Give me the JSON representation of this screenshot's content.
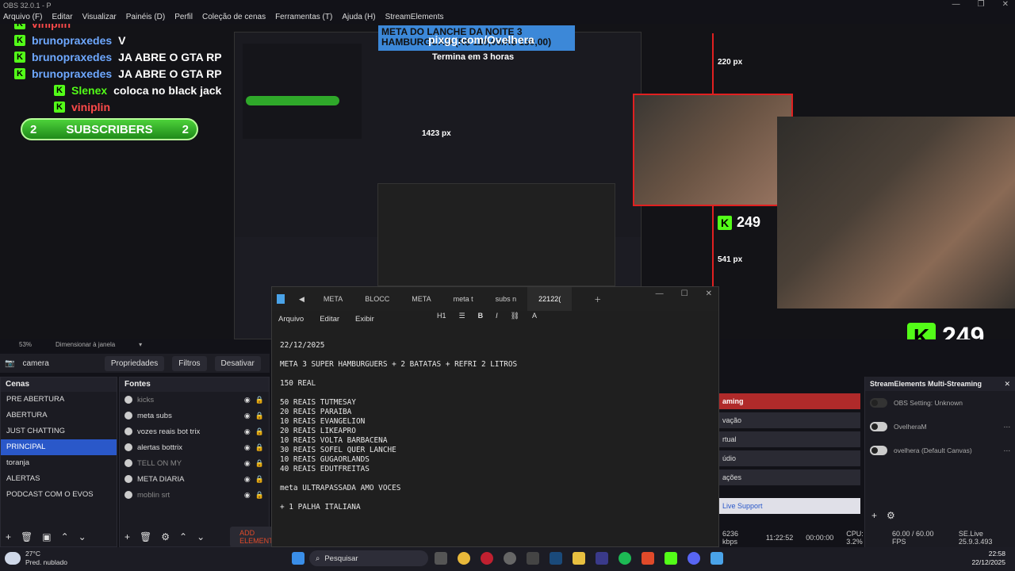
{
  "window": {
    "title": "OBS 32.0.1 - P",
    "menu": [
      "Arquivo (F)",
      "Editar",
      "Visualizar",
      "Painéis (D)",
      "Perfil",
      "Coleção de cenas",
      "Ferramentas (T)",
      "Ajuda (H)",
      "StreamElements"
    ]
  },
  "preview": {
    "url_banner": "pixgg.com/Ovelhera",
    "meta_banner_line1": "META DO LANCHE DA NOITE 3",
    "meta_banner_line2": "HAMBURGUAO (R$ 110,00/R$ 150,00)",
    "termina": "Termina em 3 horas",
    "chat": [
      {
        "user": "viniplin",
        "msg": "",
        "color": "red"
      },
      {
        "user": "brunopraxedes",
        "msg": "V",
        "color": "blue"
      },
      {
        "user": "brunopraxedes",
        "msg": "JA ABRE O GTA RP",
        "color": "blue"
      },
      {
        "user": "brunopraxedes",
        "msg": "JA ABRE O GTA RP",
        "color": "blue"
      },
      {
        "user": "Slenex",
        "msg": "coloca no black jack",
        "color": "green"
      },
      {
        "user": "viniplin",
        "msg": "",
        "color": "red"
      }
    ],
    "subscribers_label": "SUBSCRIBERS",
    "subscribers_count_left": "2",
    "subscribers_count_right": "2",
    "kick_count_big": "249",
    "kick_count_mid": "249",
    "size_220": "220 px",
    "size_541": "541 px",
    "size_1423": "1423 px",
    "k_letter": "K"
  },
  "zoom": {
    "percent": "53%",
    "mode": "Dimensionar à janela"
  },
  "source_toolbar": {
    "camera": "camera",
    "props": "Propriedades",
    "filters": "Filtros",
    "deactivate": "Desativar"
  },
  "scenes": {
    "title": "Cenas",
    "items": [
      "PRE ABERTURA",
      "ABERTURA",
      "JUST CHATTING",
      "PRINCIPAL",
      "toranja",
      "ALERTAS",
      "PODCAST COM O EVOS"
    ],
    "active_index": 3
  },
  "sources": {
    "title": "Fontes",
    "items": [
      {
        "name": "kicks",
        "dim": true
      },
      {
        "name": "meta subs",
        "dim": false
      },
      {
        "name": "vozes reais bot trix",
        "dim": false
      },
      {
        "name": "alertas bottrix",
        "dim": false
      },
      {
        "name": "TELL ON MY",
        "dim": true
      },
      {
        "name": "META DIARIA",
        "dim": false
      },
      {
        "name": "moblin srt",
        "dim": true
      }
    ],
    "add_element": "ADD ELEMENT"
  },
  "controls": {
    "items": [
      "aming",
      "vação",
      "rtual",
      "údio",
      "ações"
    ],
    "live_support": "Live Support"
  },
  "streamelements": {
    "title": "StreamElements Multi-Streaming",
    "rows": [
      {
        "label": "OBS Setting: Unknown",
        "on": false
      },
      {
        "label": "OvelheraM",
        "on": true
      },
      {
        "label": "ovelhera (Default Canvas)",
        "on": true
      }
    ]
  },
  "status_bar": {
    "kbps": "6236 kbps",
    "time1": "11:22:52",
    "time2": "00:00:00",
    "cpu": "CPU: 3.2%",
    "fps": "60.00 / 60.00 FPS",
    "version": "SE.Live 25.9.3.493"
  },
  "notepad": {
    "tabs": [
      "META",
      "BLOCC",
      "META",
      "meta t",
      "subs n",
      "22122("
    ],
    "active_tab": 5,
    "menu": [
      "Arquivo",
      "Editar",
      "Exibir"
    ],
    "heading": "H1",
    "lines": [
      "22/12/2025",
      "",
      "META 3 SUPER HAMBURGUERS + 2 BATATAS + REFRI 2 LITROS",
      "",
      "150 REAL",
      "",
      "50 REAIS TUTMESAY",
      "20 REAIS PARAIBA",
      "10 REAIS EVANGELION",
      "20 REAIS LIKEAPRO",
      "10 REAIS VOLTA BARBACENA",
      "30 REAIS SOFEL QUER LANCHE",
      "10 REAIS GUGAORLANDS",
      "40 REAIS EDUTFREITAS",
      "",
      "meta ULTRAPASSADA AMO VOCES",
      "",
      "+ 1 PALHA ITALIANA"
    ]
  },
  "taskbar": {
    "temp": "27°C",
    "weather": "Pred. nublado",
    "search": "Pesquisar",
    "time": "22:58",
    "date": "22/12/2025"
  },
  "colors": {
    "kick_green": "#53fc18",
    "accent_blue": "#2a58c9",
    "selection_red": "#e02020"
  }
}
